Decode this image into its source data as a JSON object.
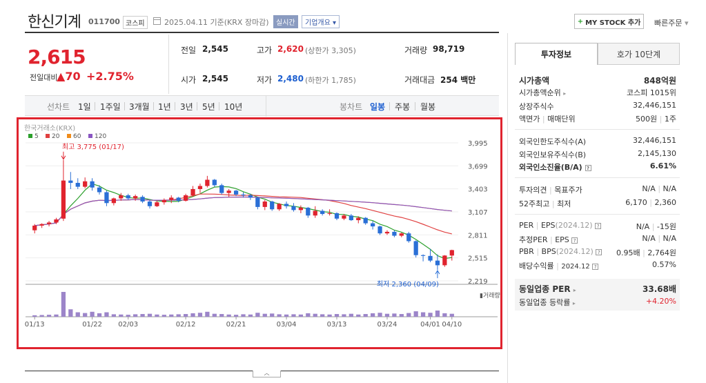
{
  "header": {
    "company_name": "한신기계",
    "stock_code": "011700",
    "market": "코스피",
    "date_text": "2025.04.11  기준(KRX 장마감)",
    "realtime": "실시간",
    "profile": "기업개요",
    "mystock": "MY STOCK 추가",
    "quick_order": "빠른주문"
  },
  "price": {
    "current": "2,615",
    "change_label": "전일대비",
    "change": "70",
    "rate": "+2.75%"
  },
  "stats": {
    "prev_label": "전일",
    "prev": "2,545",
    "high_label": "고가",
    "high": "2,620",
    "upper_limit": "(상한가 3,305)",
    "volume_label": "거래량",
    "volume": "98,719",
    "open_label": "시가",
    "open": "2,545",
    "low_label": "저가",
    "low": "2,480",
    "lower_limit": "(하한가 1,785)",
    "amount_label": "거래대금",
    "amount": "254 백만"
  },
  "period_bar": {
    "line_label": "선차트",
    "periods": [
      "1일",
      "1주일",
      "3개월",
      "1년",
      "3년",
      "5년",
      "10년"
    ],
    "candle_label": "봉차트",
    "candle_periods": [
      "일봉",
      "주봉",
      "월봉"
    ]
  },
  "chart_data": {
    "type": "candlestick",
    "title": "한국거래소(KRX)",
    "legend": [
      {
        "name": "5",
        "color": "#2ca02c"
      },
      {
        "name": "20",
        "color": "#e04040"
      },
      {
        "name": "60",
        "color": "#f08c1a"
      },
      {
        "name": "120",
        "color": "#8a56c2"
      }
    ],
    "y_ticks": [
      3995,
      3699,
      3403,
      3107,
      2811,
      2515,
      2219
    ],
    "ylim": [
      2219,
      3995
    ],
    "x_ticks": [
      "01/13",
      "01/22",
      "02/03",
      "02/12",
      "02/21",
      "03/04",
      "03/13",
      "03/24",
      "04/01",
      "04/10"
    ],
    "max_label": "최고 3,775 (01/17)",
    "min_label": "최저 2,360 (04/09)",
    "volume_label": "거래량",
    "candles": [
      [
        2870,
        2950,
        2830,
        2930
      ],
      [
        2930,
        2960,
        2900,
        2950
      ],
      [
        2950,
        2990,
        2920,
        2970
      ],
      [
        2970,
        3030,
        2950,
        3010
      ],
      [
        3020,
        3775,
        2990,
        3510
      ],
      [
        3510,
        3620,
        3400,
        3480
      ],
      [
        3480,
        3540,
        3400,
        3430
      ],
      [
        3430,
        3550,
        3410,
        3500
      ],
      [
        3500,
        3540,
        3380,
        3420
      ],
      [
        3420,
        3450,
        3330,
        3360
      ],
      [
        3360,
        3380,
        3180,
        3220
      ],
      [
        3220,
        3290,
        3190,
        3280
      ],
      [
        3280,
        3350,
        3250,
        3320
      ],
      [
        3320,
        3340,
        3260,
        3280
      ],
      [
        3280,
        3330,
        3250,
        3310
      ],
      [
        3300,
        3320,
        3220,
        3240
      ],
      [
        3240,
        3260,
        3150,
        3180
      ],
      [
        3180,
        3250,
        3170,
        3230
      ],
      [
        3230,
        3280,
        3200,
        3260
      ],
      [
        3260,
        3320,
        3220,
        3290
      ],
      [
        3290,
        3300,
        3230,
        3250
      ],
      [
        3250,
        3340,
        3240,
        3320
      ],
      [
        3320,
        3440,
        3300,
        3400
      ],
      [
        3400,
        3470,
        3350,
        3440
      ],
      [
        3440,
        3570,
        3420,
        3520
      ],
      [
        3520,
        3530,
        3430,
        3450
      ],
      [
        3450,
        3470,
        3330,
        3350
      ],
      [
        3350,
        3400,
        3300,
        3380
      ],
      [
        3380,
        3390,
        3310,
        3330
      ],
      [
        3330,
        3360,
        3290,
        3320
      ],
      [
        3320,
        3340,
        3260,
        3290
      ],
      [
        3290,
        3300,
        3140,
        3170
      ],
      [
        3170,
        3260,
        3130,
        3240
      ],
      [
        3240,
        3250,
        3120,
        3140
      ],
      [
        3140,
        3220,
        3120,
        3210
      ],
      [
        3210,
        3240,
        3150,
        3180
      ],
      [
        3180,
        3220,
        3110,
        3130
      ],
      [
        3130,
        3190,
        3090,
        3160
      ],
      [
        3160,
        3170,
        3030,
        3060
      ],
      [
        3060,
        3180,
        3030,
        3120
      ],
      [
        3120,
        3140,
        3060,
        3080
      ],
      [
        3080,
        3140,
        3060,
        3090
      ],
      [
        3090,
        3100,
        3000,
        3020
      ],
      [
        3020,
        3080,
        3000,
        3060
      ],
      [
        3060,
        3080,
        2990,
        3000
      ],
      [
        3000,
        3050,
        2960,
        3030
      ],
      [
        3030,
        3040,
        2940,
        2960
      ],
      [
        2960,
        2990,
        2880,
        2920
      ],
      [
        2920,
        2930,
        2810,
        2830
      ],
      [
        2830,
        2870,
        2810,
        2850
      ],
      [
        2850,
        2870,
        2780,
        2800
      ],
      [
        2800,
        2840,
        2780,
        2830
      ],
      [
        2830,
        2850,
        2710,
        2730
      ],
      [
        2730,
        2740,
        2520,
        2550
      ],
      [
        2550,
        2560,
        2470,
        2540
      ],
      [
        2540,
        2630,
        2460,
        2480
      ],
      [
        2480,
        2560,
        2360,
        2420
      ],
      [
        2420,
        2550,
        2400,
        2545
      ],
      [
        2545,
        2620,
        2480,
        2615
      ]
    ],
    "volumes": [
      6,
      7,
      8,
      9,
      100,
      30,
      18,
      15,
      20,
      14,
      18,
      10,
      9,
      8,
      10,
      11,
      12,
      9,
      8,
      9,
      10,
      11,
      14,
      16,
      20,
      12,
      11,
      9,
      8,
      10,
      9,
      16,
      12,
      13,
      10,
      9,
      10,
      9,
      14,
      12,
      10,
      9,
      11,
      10,
      12,
      9,
      11,
      14,
      16,
      12,
      13,
      11,
      15,
      22,
      18,
      16,
      25,
      14,
      12
    ]
  },
  "right_panel": {
    "tab_invest": "투자정보",
    "tab_hoga": "호가 10단계",
    "market_cap_label": "시가총액",
    "market_cap": "848억원",
    "cap_rank_label": "시가총액순위",
    "cap_rank": "코스피 1015위",
    "shares_label": "상장주식수",
    "shares": "32,446,151",
    "par_label": "액면가",
    "unit_label": "매매단위",
    "par": "500원",
    "unit": "1주",
    "foreign_limit_label": "외국인한도주식수(A)",
    "foreign_limit": "32,446,151",
    "foreign_hold_label": "외국인보유주식수(B)",
    "foreign_hold": "2,145,130",
    "foreign_rate_label": "외국인소진율(B/A)",
    "foreign_rate": "6.61%",
    "opinion_label": "투자의견",
    "target_label": "목표주가",
    "opinion": "N/A",
    "target": "N/A",
    "w52_high_label": "52주최고",
    "w52_low_label": "최저",
    "w52_high": "6,170",
    "w52_low": "2,360",
    "per_label": "PER",
    "eps_label": "EPS",
    "year_label": "(2024.12)",
    "per": "N/A",
    "eps": "-15원",
    "est_per_label": "추정PER",
    "est_eps_label": "EPS",
    "est_per": "N/A",
    "est_eps": "N/A",
    "pbr_label": "PBR",
    "bps_label": "BPS",
    "pbr": "0.95배",
    "bps": "2,764원",
    "div_label": "배당수익률",
    "div_year": "2024.12",
    "div": "0.57%",
    "peer_per_label": "동일업종 PER",
    "peer_per": "33.68배",
    "peer_rate_label": "동일업종 등락률",
    "peer_rate": "+4.20%"
  }
}
